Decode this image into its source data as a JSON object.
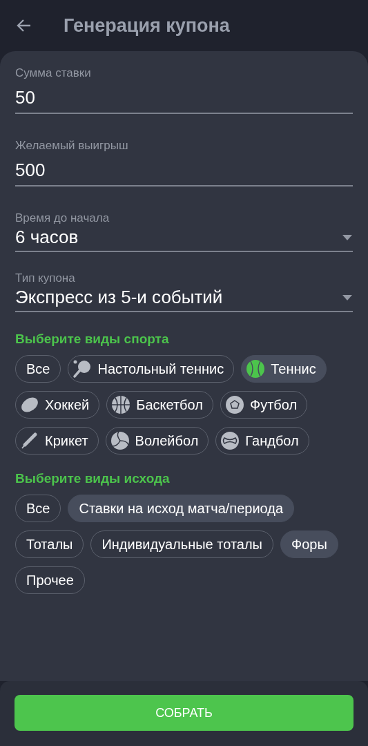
{
  "header": {
    "title": "Генерация купона"
  },
  "fields": [
    {
      "kind": "input",
      "label": "Сумма ставки",
      "value": "50"
    },
    {
      "kind": "input",
      "label": "Желаемый выигрыш",
      "value": "500"
    },
    {
      "kind": "select",
      "label": "Время до начала",
      "value": "6 часов"
    },
    {
      "kind": "select",
      "label": "Тип купона",
      "value": "Экспресс из 5-и событий"
    }
  ],
  "sports": {
    "title": "Выберите виды спорта",
    "items": [
      {
        "label": "Все",
        "kind": "all",
        "selected": false
      },
      {
        "label": "Настольный теннис",
        "kind": "table-tennis",
        "selected": false
      },
      {
        "label": "Теннис",
        "kind": "tennis",
        "selected": true
      },
      {
        "label": "Хоккей",
        "kind": "hockey",
        "selected": false
      },
      {
        "label": "Баскетбол",
        "kind": "basketball",
        "selected": false
      },
      {
        "label": "Футбол",
        "kind": "football",
        "selected": false
      },
      {
        "label": "Крикет",
        "kind": "cricket",
        "selected": false
      },
      {
        "label": "Волейбол",
        "kind": "volleyball",
        "selected": false
      },
      {
        "label": "Гандбол",
        "kind": "handball",
        "selected": false
      }
    ]
  },
  "outcomes": {
    "title": "Выберите виды исхода",
    "items": [
      {
        "label": "Все",
        "selected": false
      },
      {
        "label": "Ставки на исход матча/периода",
        "selected": true
      },
      {
        "label": "Тоталы",
        "selected": false
      },
      {
        "label": "Индивидуальные тоталы",
        "selected": false
      },
      {
        "label": "Форы",
        "selected": true
      },
      {
        "label": "Прочее",
        "selected": false
      }
    ]
  },
  "submit": {
    "label": "СОБРАТЬ"
  }
}
